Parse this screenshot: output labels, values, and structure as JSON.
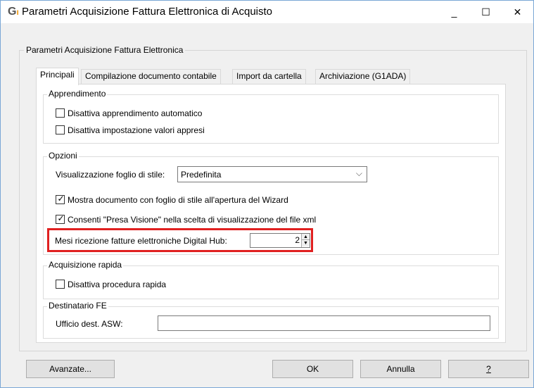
{
  "window": {
    "title": "Parametri Acquisizione Fattura Elettronica di Acquisto",
    "min_label": "_",
    "max_label": "☐",
    "close_label": "✕"
  },
  "main_group": {
    "legend": "Parametri Acquisizione Fattura Elettronica"
  },
  "tabs": [
    {
      "label": "Principali",
      "active": true
    },
    {
      "label": "Compilazione documento contabile",
      "active": false
    },
    {
      "label": "Import da cartella",
      "active": false
    },
    {
      "label": "Archiviazione (G1ADA)",
      "active": false
    }
  ],
  "apprendimento": {
    "legend": "Apprendimento",
    "options": [
      {
        "label": "Disattiva apprendimento automatico",
        "checked": false
      },
      {
        "label": "Disattiva impostazione valori appresi",
        "checked": false
      }
    ]
  },
  "opzioni": {
    "legend": "Opzioni",
    "stylesheet_label": "Visualizzazione foglio di stile:",
    "stylesheet_value": "Predefinita",
    "options": [
      {
        "label": "Mostra documento con foglio di stile all'apertura del Wizard",
        "checked": true
      },
      {
        "label": "Consenti \"Presa Visione\" nella scelta di visualizzazione del file xml",
        "checked": true
      }
    ],
    "months_label": "Mesi ricezione fatture elettroniche Digital Hub:",
    "months_value": "2"
  },
  "acquisizione": {
    "legend": "Acquisizione rapida",
    "option": {
      "label": "Disattiva procedura rapida",
      "checked": false
    }
  },
  "destinatario": {
    "legend": "Destinatario FE",
    "office_label": "Ufficio dest. ASW:",
    "office_value": ""
  },
  "buttons": {
    "advanced": "Avanzate...",
    "ok": "OK",
    "cancel": "Annulla",
    "help": "?"
  },
  "colors": {
    "highlight": "#e02020",
    "window_border": "#7aa7d6"
  }
}
